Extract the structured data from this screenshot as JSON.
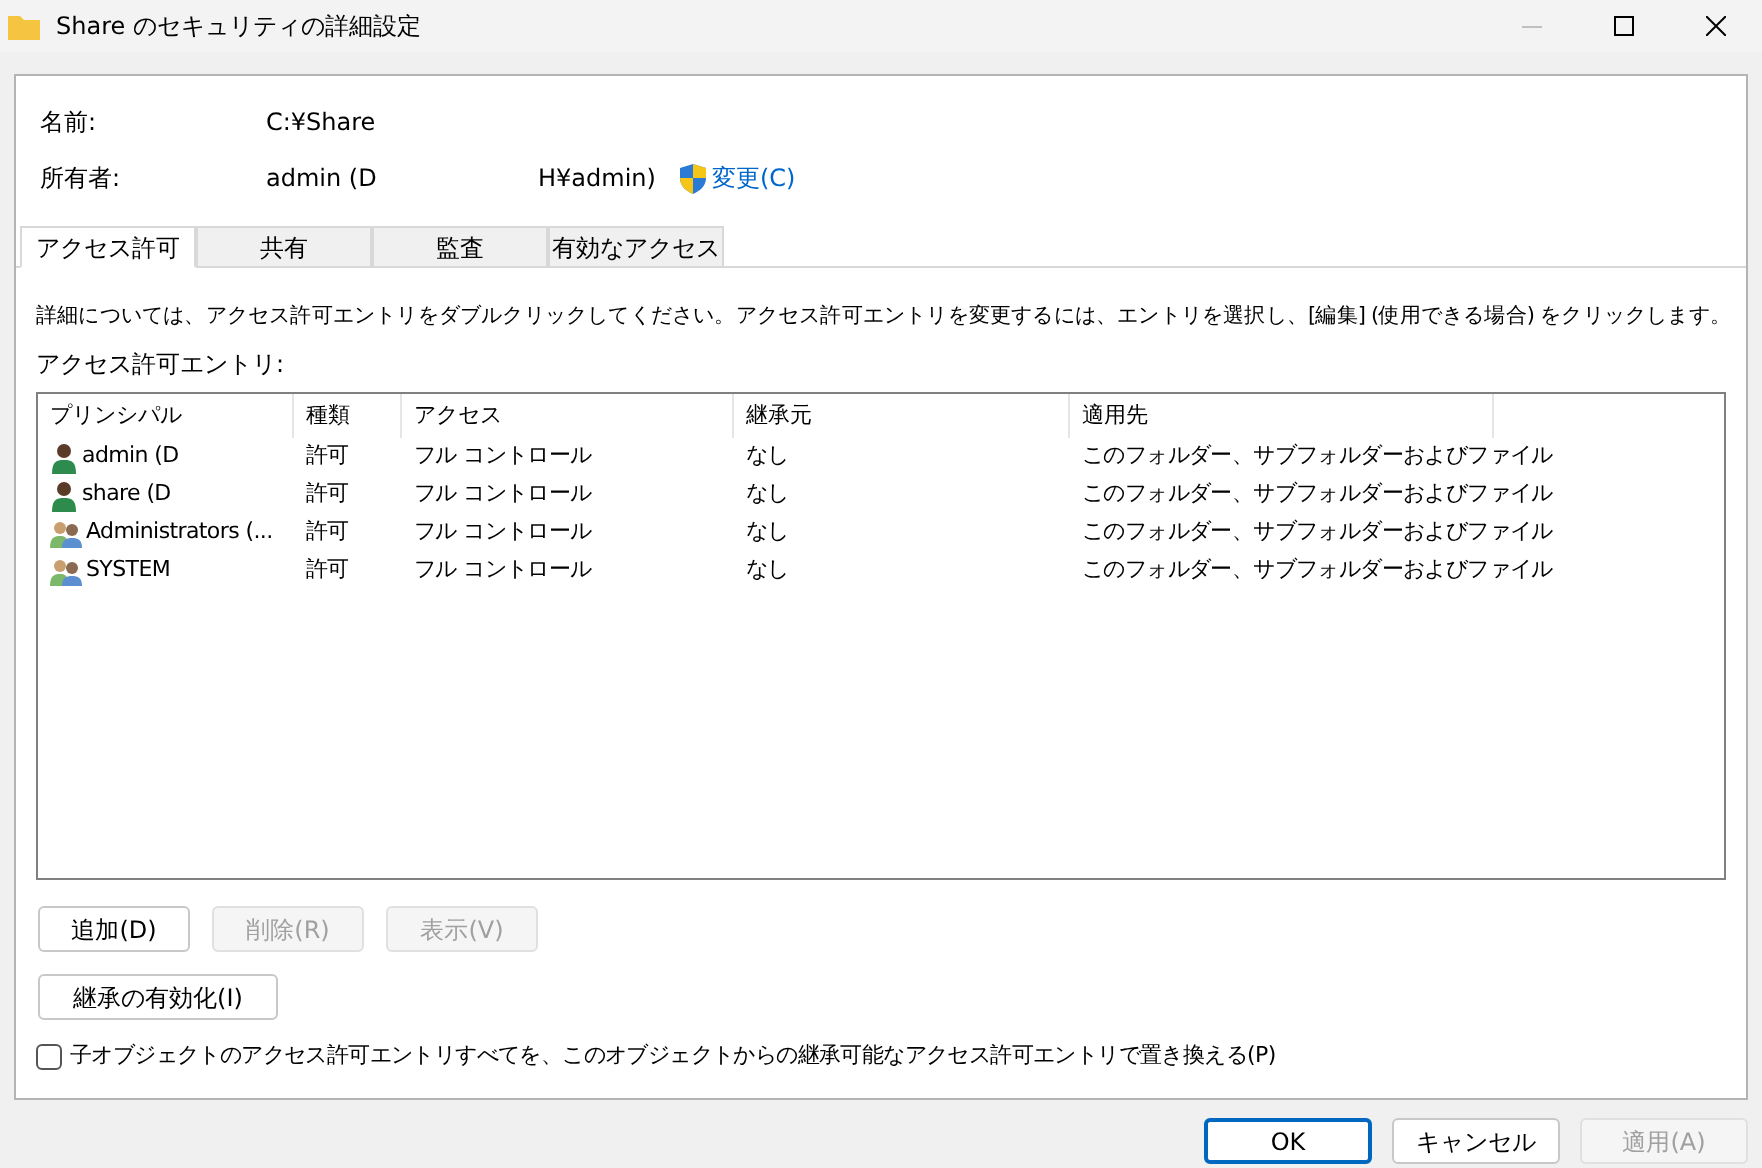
{
  "window": {
    "title": "Share のセキュリティの詳細設定",
    "minimize_disabled": true
  },
  "name": {
    "label": "名前:",
    "value": "C:¥Share"
  },
  "owner": {
    "label": "所有者:",
    "value_start": "admin (D",
    "value_end": "H¥admin)",
    "change": "変更(C)"
  },
  "tabs": [
    {
      "label": "アクセス許可",
      "selected": true
    },
    {
      "label": "共有",
      "selected": false
    },
    {
      "label": "監査",
      "selected": false
    },
    {
      "label": "有効なアクセス",
      "selected": false
    }
  ],
  "instructions": "詳細については、アクセス許可エントリをダブルクリックしてください。アクセス許可エントリを変更するには、エントリを選択し、[編集] (使用できる場合) をクリックします。",
  "entries_label": "アクセス許可エントリ:",
  "table": {
    "columns": [
      "プリンシパル",
      "種類",
      "アクセス",
      "継承元",
      "適用先"
    ],
    "rows": [
      {
        "kind": "user",
        "cells": [
          "admin (D",
          "許可",
          "フル コントロール",
          "なし",
          "このフォルダー、サブフォルダーおよびファイル"
        ]
      },
      {
        "kind": "user",
        "cells": [
          "share (D",
          "許可",
          "フル コントロール",
          "なし",
          "このフォルダー、サブフォルダーおよびファイル"
        ]
      },
      {
        "kind": "group",
        "cells": [
          "Administrators (...",
          "許可",
          "フル コントロール",
          "なし",
          "このフォルダー、サブフォルダーおよびファイル"
        ]
      },
      {
        "kind": "group",
        "cells": [
          "SYSTEM",
          "許可",
          "フル コントロール",
          "なし",
          "このフォルダー、サブフォルダーおよびファイル"
        ]
      }
    ]
  },
  "entry_buttons": [
    {
      "label": "追加(D)",
      "disabled": false
    },
    {
      "label": "削除(R)",
      "disabled": true
    },
    {
      "label": "表示(V)",
      "disabled": true
    }
  ],
  "inheritance_button": {
    "label": "継承の有効化(I)",
    "disabled": false
  },
  "replace_checkbox": {
    "label": "子オブジェクトのアクセス許可エントリすべてを、このオブジェクトからの継承可能なアクセス許可エントリで置き換える(P)",
    "checked": false
  },
  "footer_buttons": [
    {
      "label": "OK",
      "disabled": false,
      "default": true
    },
    {
      "label": "キャンセル",
      "disabled": false,
      "default": false
    },
    {
      "label": "適用(A)",
      "disabled": true,
      "default": false
    }
  ]
}
